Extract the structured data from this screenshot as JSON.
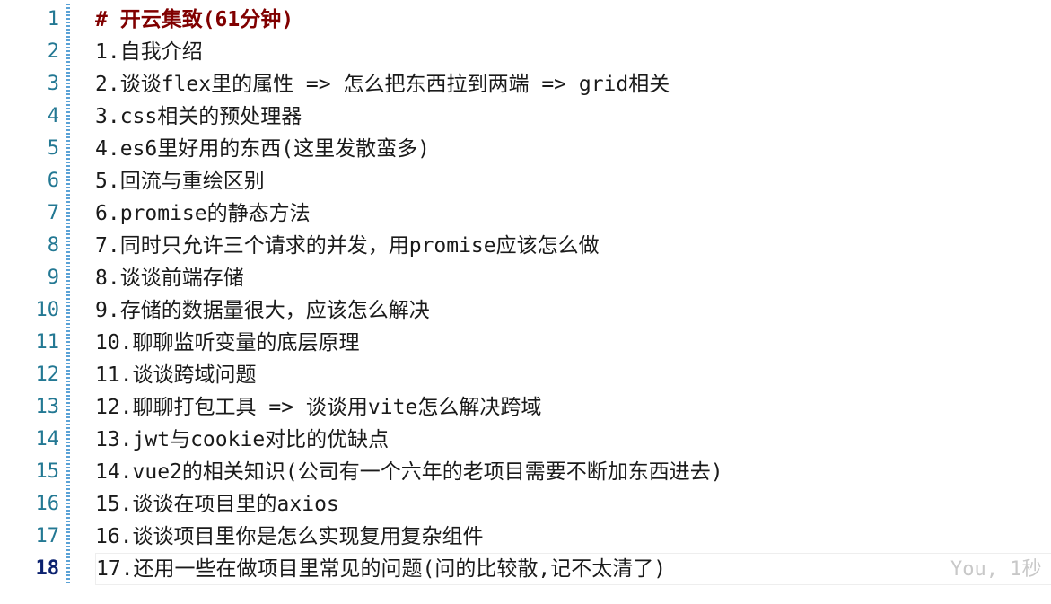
{
  "editor": {
    "active_line": 18,
    "blame": "You, 1秒",
    "lines": [
      {
        "num": "1",
        "text": "# 开云集致(61分钟)"
      },
      {
        "num": "2",
        "text": "1.自我介绍"
      },
      {
        "num": "3",
        "text": "2.谈谈flex里的属性 => 怎么把东西拉到两端 => grid相关"
      },
      {
        "num": "4",
        "text": "3.css相关的预处理器"
      },
      {
        "num": "5",
        "text": "4.es6里好用的东西(这里发散蛮多)"
      },
      {
        "num": "6",
        "text": "5.回流与重绘区别"
      },
      {
        "num": "7",
        "text": "6.promise的静态方法"
      },
      {
        "num": "8",
        "text": "7.同时只允许三个请求的并发，用promise应该怎么做"
      },
      {
        "num": "9",
        "text": "8.谈谈前端存储"
      },
      {
        "num": "10",
        "text": "9.存储的数据量很大，应该怎么解决"
      },
      {
        "num": "11",
        "text": "10.聊聊监听变量的底层原理"
      },
      {
        "num": "12",
        "text": "11.谈谈跨域问题"
      },
      {
        "num": "13",
        "text": "12.聊聊打包工具 => 谈谈用vite怎么解决跨域"
      },
      {
        "num": "14",
        "text": "13.jwt与cookie对比的优缺点"
      },
      {
        "num": "15",
        "text": "14.vue2的相关知识(公司有一个六年的老项目需要不断加东西进去)"
      },
      {
        "num": "16",
        "text": "15.谈谈在项目里的axios"
      },
      {
        "num": "17",
        "text": "16.谈谈项目里你是怎么实现复用复杂组件"
      },
      {
        "num": "18",
        "text": "17.还用一些在做项目里常见的问题(问的比较散,记不太清了)"
      }
    ]
  }
}
